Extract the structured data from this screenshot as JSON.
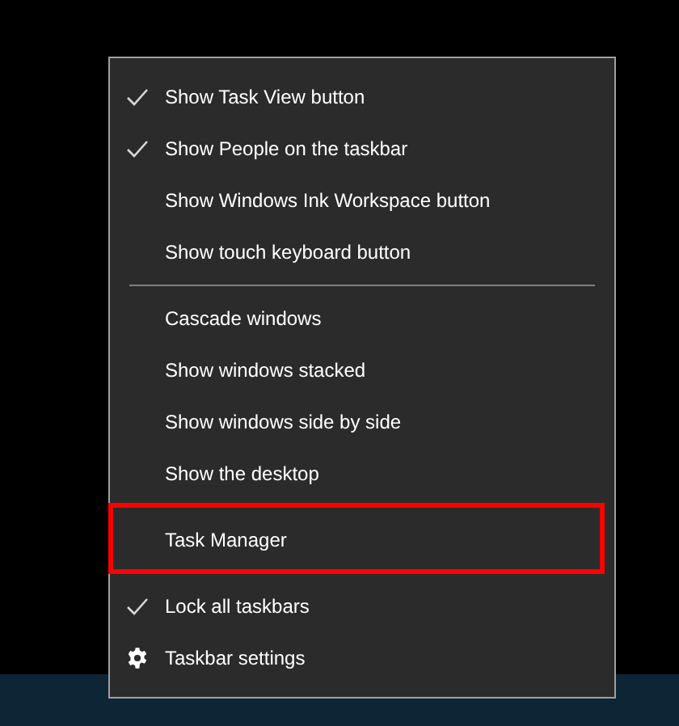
{
  "menu": {
    "sections": [
      {
        "items": [
          {
            "label": "Show Task View button",
            "checked": true,
            "kind": "toggle",
            "highlighted": false
          },
          {
            "label": "Show People on the taskbar",
            "checked": true,
            "kind": "toggle",
            "highlighted": false
          },
          {
            "label": "Show Windows Ink Workspace button",
            "checked": false,
            "kind": "toggle",
            "highlighted": false
          },
          {
            "label": "Show touch keyboard button",
            "checked": false,
            "kind": "toggle",
            "highlighted": false
          }
        ]
      },
      {
        "items": [
          {
            "label": "Cascade windows",
            "checked": false,
            "kind": "toggle",
            "highlighted": false
          },
          {
            "label": "Show windows stacked",
            "checked": false,
            "kind": "toggle",
            "highlighted": false
          },
          {
            "label": "Show windows side by side",
            "checked": false,
            "kind": "toggle",
            "highlighted": false
          },
          {
            "label": "Show the desktop",
            "checked": false,
            "kind": "toggle",
            "highlighted": false
          }
        ]
      },
      {
        "items": [
          {
            "label": "Task Manager",
            "checked": false,
            "kind": "toggle",
            "highlighted": true
          }
        ]
      },
      {
        "items": [
          {
            "label": "Lock all taskbars",
            "checked": true,
            "kind": "toggle",
            "highlighted": false
          },
          {
            "label": "Taskbar settings",
            "checked": false,
            "kind": "settings",
            "highlighted": false
          }
        ]
      }
    ]
  }
}
